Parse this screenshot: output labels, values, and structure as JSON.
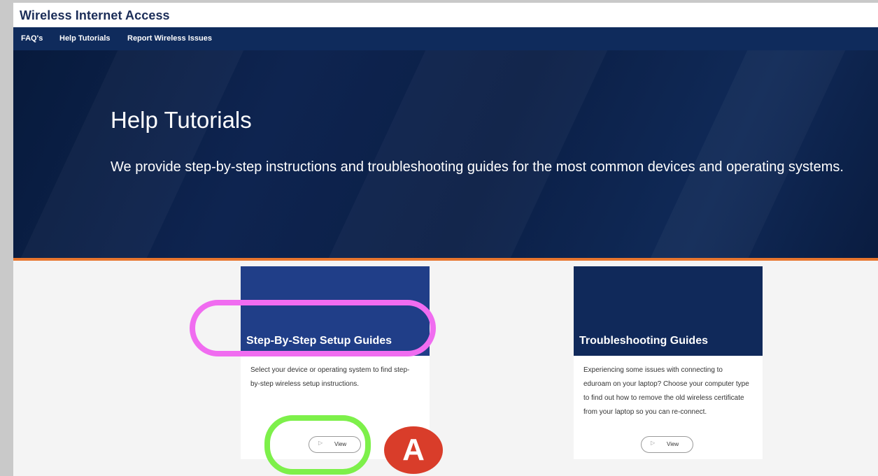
{
  "site": {
    "title": "Wireless Internet Access"
  },
  "nav": {
    "items": [
      {
        "label": "FAQ's"
      },
      {
        "label": "Help Tutorials"
      },
      {
        "label": "Report Wireless Issues"
      }
    ]
  },
  "hero": {
    "title": "Help Tutorials",
    "description": "We provide step-by-step instructions and troubleshooting guides for the  most common devices and operating systems."
  },
  "cards": [
    {
      "title": "Step-By-Step Setup Guides",
      "body": "Select your device or operating system to find step-by-step wireless setup instructions.",
      "button": "View"
    },
    {
      "title": "Troubleshooting Guides",
      "body": "Experiencing some issues with connecting to eduroam on your laptop? Choose your computer type to find out how to remove the old wireless certificate from your laptop so you can re-connect.",
      "button": "View"
    }
  ],
  "annotation": {
    "badge": "A"
  },
  "colors": {
    "navy": "#0f2b5c",
    "accent_orange": "#e8762e",
    "highlight_pink": "#f06cf0",
    "highlight_green": "#7df04a",
    "badge_red": "#d93d2a"
  },
  "icons": {
    "view_button": "play-icon"
  }
}
